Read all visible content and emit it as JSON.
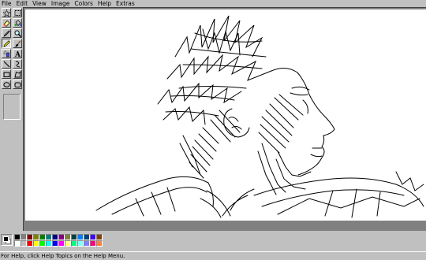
{
  "menu": [
    "File",
    "Edit",
    "View",
    "Image",
    "Colors",
    "Help",
    "Extras"
  ],
  "tools": [
    {
      "name": "free-form-select-icon",
      "glyph": "star"
    },
    {
      "name": "select-icon",
      "glyph": "rect-dash"
    },
    {
      "name": "eraser-icon",
      "glyph": "eraser"
    },
    {
      "name": "fill-with-color-icon",
      "glyph": "bucket"
    },
    {
      "name": "pick-color-icon",
      "glyph": "dropper"
    },
    {
      "name": "magnifier-icon",
      "glyph": "magnifier"
    },
    {
      "name": "pencil-icon",
      "glyph": "pencil"
    },
    {
      "name": "brush-icon",
      "glyph": "brush"
    },
    {
      "name": "airbrush-icon",
      "glyph": "airbrush"
    },
    {
      "name": "text-icon",
      "glyph": "A"
    },
    {
      "name": "line-icon",
      "glyph": "line"
    },
    {
      "name": "curve-icon",
      "glyph": "curve"
    },
    {
      "name": "rectangle-icon",
      "glyph": "rect"
    },
    {
      "name": "polygon-icon",
      "glyph": "polygon"
    },
    {
      "name": "ellipse-icon",
      "glyph": "ellipse"
    },
    {
      "name": "rounded-rectangle-icon",
      "glyph": "roundrect"
    }
  ],
  "selected_tool_index": 6,
  "colors": {
    "foreground": "#000000",
    "background": "#ffffff",
    "palette_top": [
      "#000000",
      "#808080",
      "#800000",
      "#808000",
      "#008000",
      "#008080",
      "#000080",
      "#800080",
      "#808040",
      "#004040",
      "#0080ff",
      "#004080",
      "#4000ff",
      "#804000"
    ],
    "palette_bottom": [
      "#ffffff",
      "#c0c0c0",
      "#ff0000",
      "#ffff00",
      "#00ff00",
      "#00ffff",
      "#0000ff",
      "#ff00ff",
      "#ffff80",
      "#00ff80",
      "#80ffff",
      "#8080ff",
      "#ff0080",
      "#ff8040"
    ]
  },
  "status": {
    "text": "For Help, click Help Topics on the Help Menu."
  }
}
